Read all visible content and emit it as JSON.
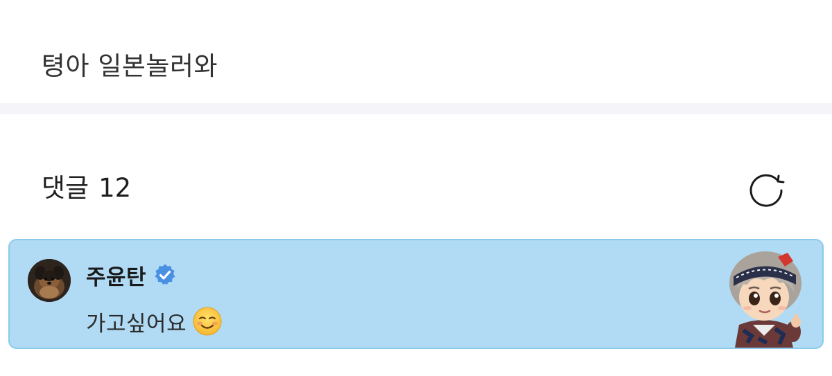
{
  "post": {
    "text": "텽아 일본놀러와"
  },
  "comments_section": {
    "label": "댓글",
    "count": "12",
    "refresh_icon": "refresh-icon"
  },
  "comment": {
    "author": "주윤탄",
    "verified_icon": "verified-badge-icon",
    "text": "가고싶어요",
    "emoji": "smiling-face-icon",
    "sticker": "character-sticker",
    "highlight_color": "#b1dbf4",
    "badge_color": "#4a90e2"
  }
}
